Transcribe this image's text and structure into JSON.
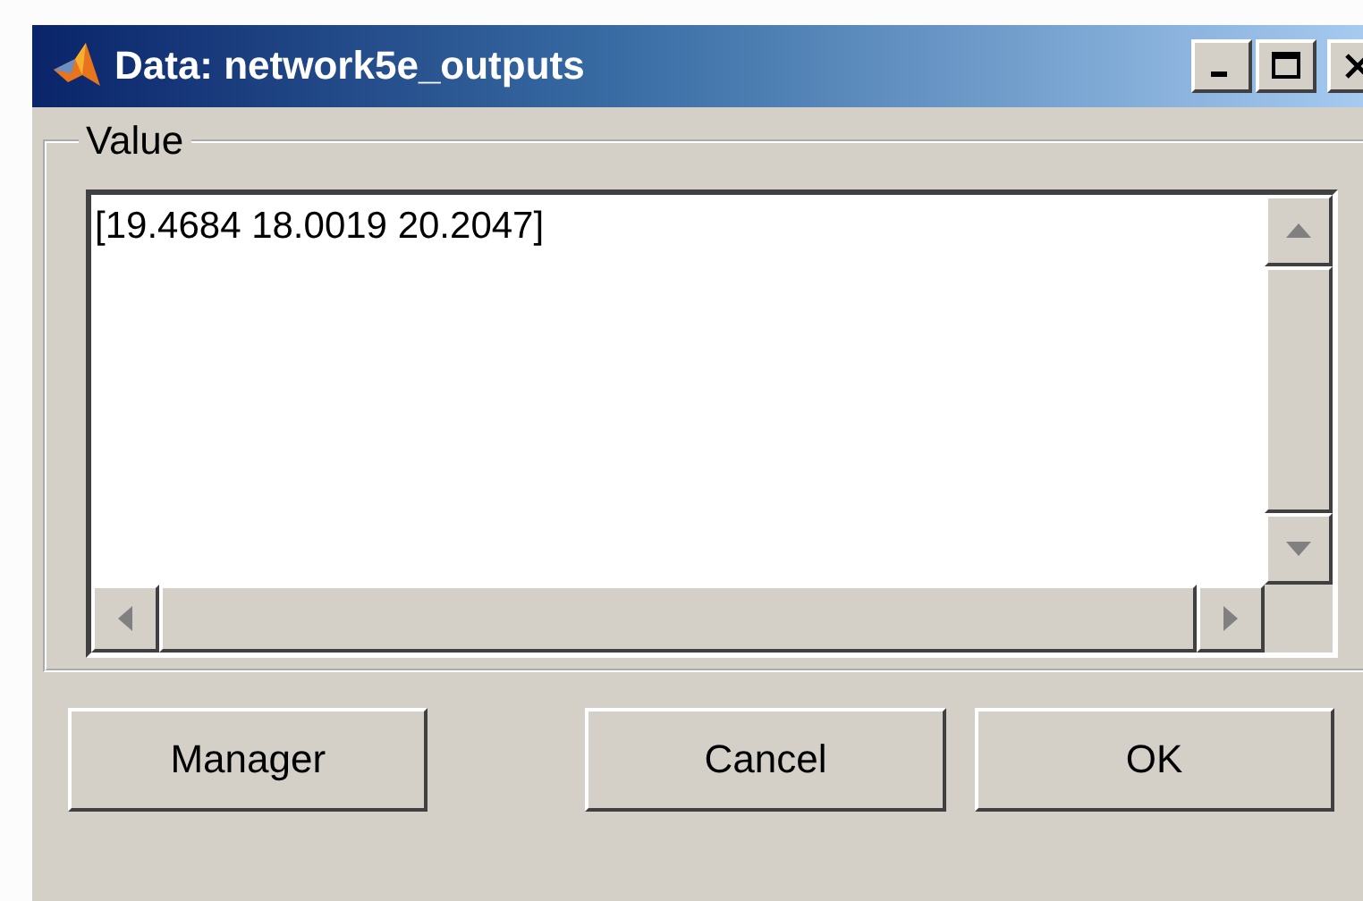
{
  "window": {
    "title": "Data: network5e_outputs"
  },
  "group": {
    "label": "Value"
  },
  "value_field": {
    "value": "[19.4684 18.0019 20.2047]"
  },
  "buttons": [
    {
      "label": "Manager"
    },
    {
      "label": "Cancel"
    },
    {
      "label": "OK"
    }
  ]
}
